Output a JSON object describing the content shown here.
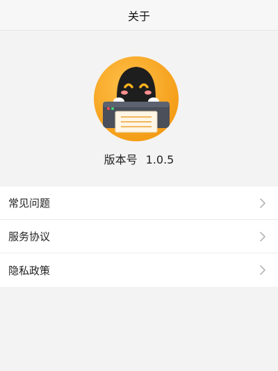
{
  "header": {
    "title": "关于"
  },
  "app": {
    "version_label": "版本号",
    "version_value": "1.0.5"
  },
  "menu": {
    "items": [
      {
        "label": "常见问题",
        "icon": "chevron-right-icon"
      },
      {
        "label": "服务协议",
        "icon": "chevron-right-icon"
      },
      {
        "label": "隐私政策",
        "icon": "chevron-right-icon"
      }
    ]
  },
  "colors": {
    "logo_orange": "#f6a623",
    "robot_dark": "#1e1e1e",
    "page_bg": "#f3f3f3"
  }
}
